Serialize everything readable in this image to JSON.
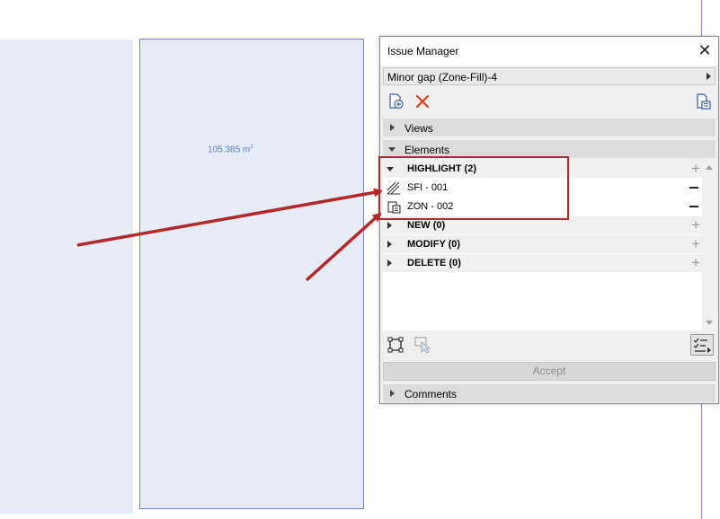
{
  "canvas": {
    "area_value": "105.385 m",
    "area_superscript": "2"
  },
  "dialog": {
    "title": "Issue Manager",
    "close_glyph": "✕",
    "issue_select": {
      "value": "Minor gap (Zone-Fill)-4"
    },
    "toolbar": {
      "new_issue_icon": "new-issue-icon",
      "delete_icon": "delete-x-icon",
      "export_icon": "export-list-icon",
      "delete_color": "#e2401c"
    },
    "sections": {
      "views": "Views",
      "elements": "Elements",
      "comments": "Comments"
    },
    "groups": [
      {
        "label": "HIGHLIGHT (2)",
        "expanded": true
      },
      {
        "label": "NEW (0)",
        "expanded": false
      },
      {
        "label": "MODIFY (0)",
        "expanded": false
      },
      {
        "label": "DELETE (0)",
        "expanded": false
      }
    ],
    "elements": [
      {
        "label": "SFI - 001",
        "icon": "fill-icon"
      },
      {
        "label": "ZON - 002",
        "icon": "zone-icon"
      }
    ],
    "plus_glyph": "+",
    "accept_label": "Accept"
  },
  "annotation": {
    "arrow_color": "#b52828",
    "highlight_box_color": "#b52828"
  }
}
